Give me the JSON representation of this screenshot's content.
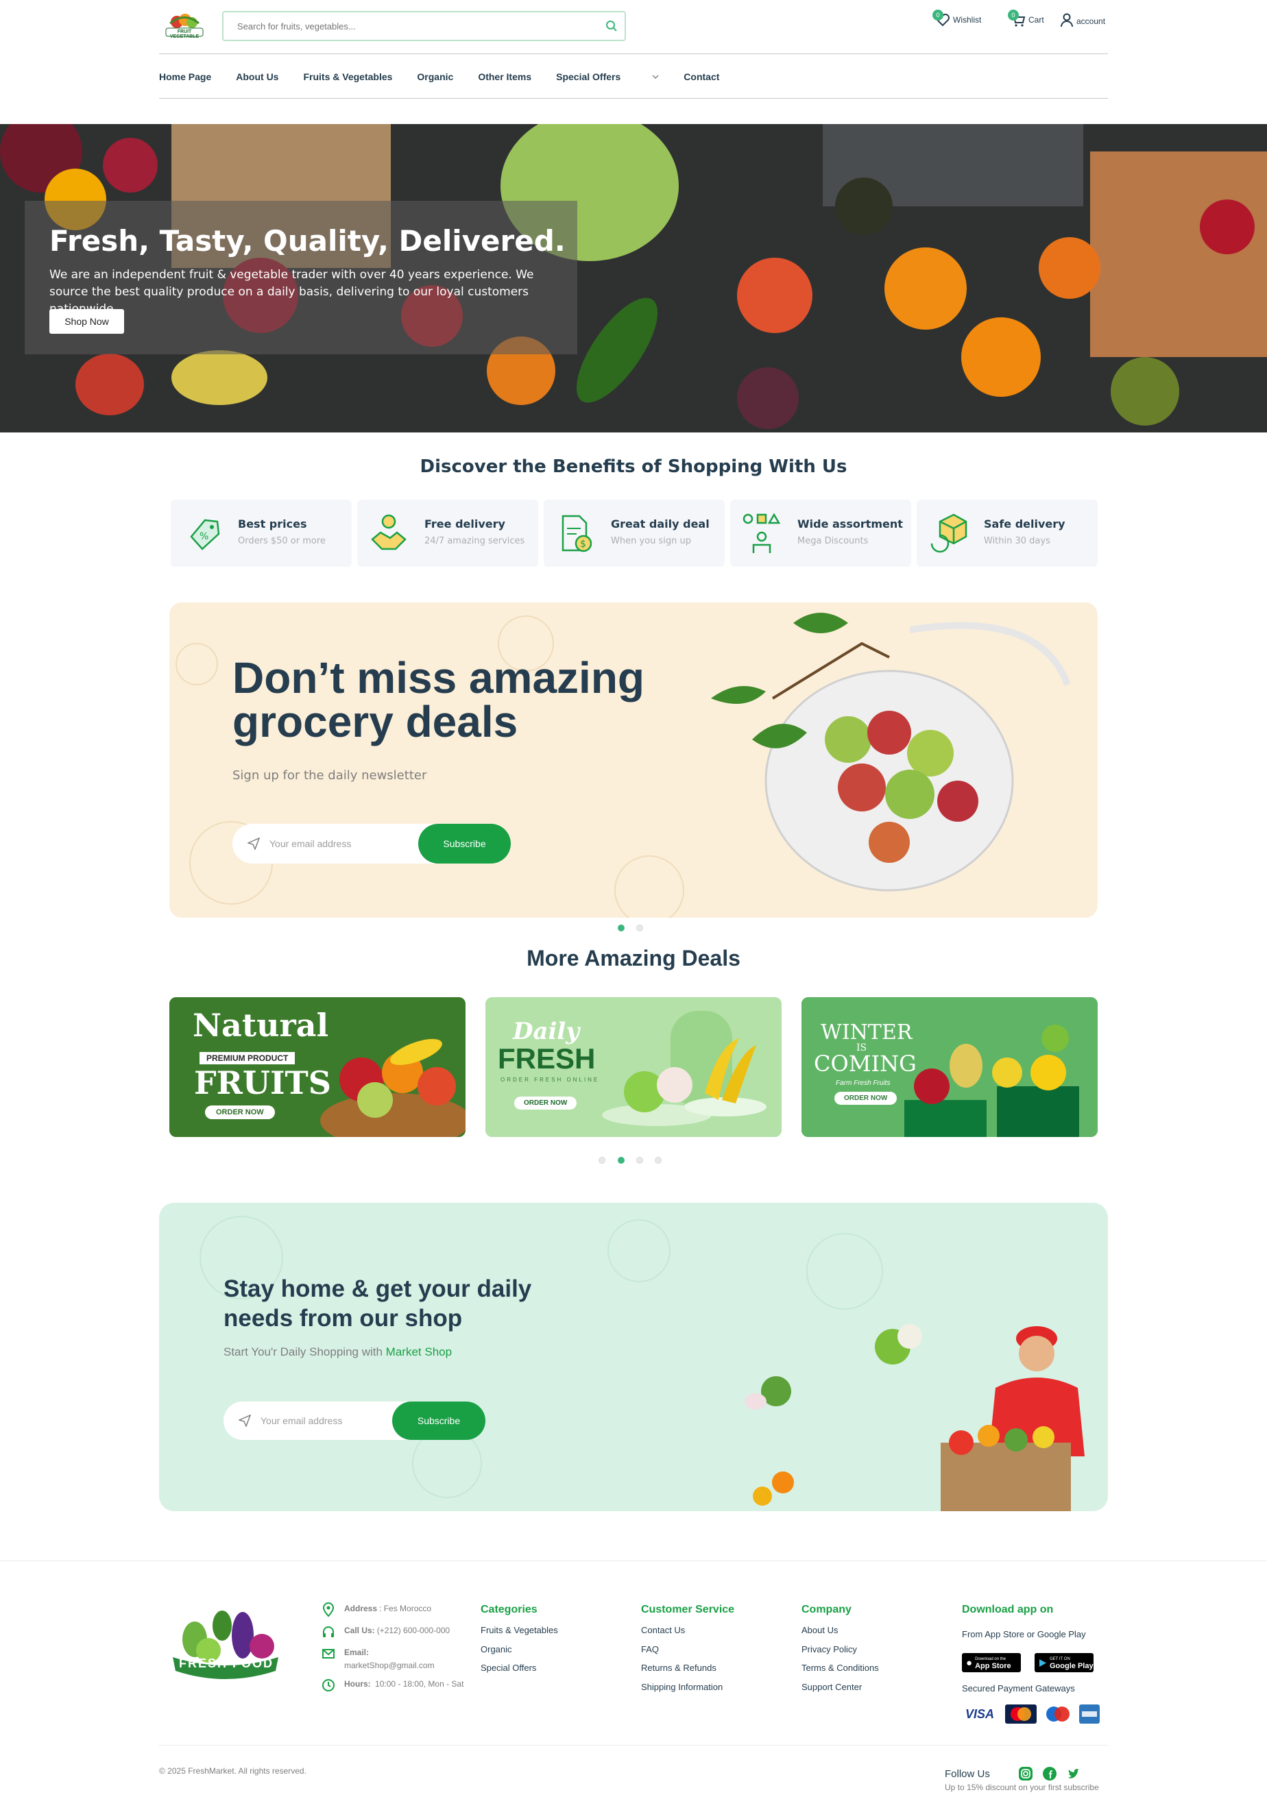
{
  "header": {
    "logo_text": "FRUIT VEGETABLE",
    "search_placeholder": "Search for fruits, vegetables...",
    "wishlist_label": "Wishlist",
    "wishlist_count": "0",
    "cart_label": "Cart",
    "cart_count": "0",
    "account_label": "account"
  },
  "nav": {
    "items": [
      "Home Page",
      "About Us",
      "Fruits & Vegetables",
      "Organic",
      "Other Items",
      "Special Offers",
      "Contact"
    ]
  },
  "hero": {
    "title": "Fresh, Tasty, Quality, Delivered.",
    "description": "We are an independent fruit & vegetable trader with over 40 years experience. We source the best quality produce on a daily basis, delivering to our loyal customers nationwide.",
    "button": "Shop Now"
  },
  "benefits": {
    "title": "Discover the Benefits of Shopping With Us",
    "items": [
      {
        "title": "Best prices",
        "subtitle": "Orders $50 or more",
        "icon": "price-tag-icon"
      },
      {
        "title": "Free delivery",
        "subtitle": "24/7 amazing services",
        "icon": "delivery-handshake-icon"
      },
      {
        "title": "Great daily deal",
        "subtitle": "When you sign up",
        "icon": "deal-document-icon"
      },
      {
        "title": "Wide assortment",
        "subtitle": "Mega Discounts",
        "icon": "assortment-icon"
      },
      {
        "title": "Safe delivery",
        "subtitle": "Within 30 days",
        "icon": "return-box-icon"
      }
    ]
  },
  "newsletter": {
    "title_line1": "Don’t miss amazing",
    "title_line2": "grocery deals",
    "subtitle": "Sign up for the daily newsletter",
    "email_placeholder": "Your email address",
    "button": "Subscribe",
    "active_slide": 1,
    "slide_count": 2
  },
  "deals": {
    "title": "More Amazing Deals",
    "cards": [
      {
        "line1": "Natural",
        "line2": "PREMIUM PRODUCT",
        "line3": "FRUITS",
        "cta": "ORDER NOW"
      },
      {
        "line1": "Daily",
        "line2": "FRESH",
        "line3": "ORDER FRESH ONLINE",
        "cta": "ORDER NOW"
      },
      {
        "line1": "WINTER",
        "line2": "IS",
        "line3": "COMING",
        "line4": "Farm Fresh Fruits",
        "cta": "ORDER NOW"
      }
    ],
    "active_slide": 2,
    "slide_count": 4
  },
  "stay": {
    "title_line1": "Stay home & get your daily",
    "title_line2": "needs from our shop",
    "subtitle_prefix": "Start You'r Daily Shopping with ",
    "subtitle_highlight": "Market Shop",
    "email_placeholder": "Your email address",
    "button": "Subscribe"
  },
  "footer": {
    "logo_text": "FRESH FOOD",
    "contact": {
      "address_label": "Address",
      "address_value": ": Fes Morocco",
      "call_label": "Call Us:",
      "call_value": "(+212) 600-000-000",
      "email_label": "Email:",
      "email_value": "marketShop@gmail.com",
      "hours_label": "Hours:",
      "hours_value": "10:00 - 18:00, Mon - Sat"
    },
    "categories": {
      "title": "Categories",
      "links": [
        "Fruits & Vegetables",
        "Organic",
        "Special Offers"
      ]
    },
    "customer_service": {
      "title": "Customer Service",
      "links": [
        "Contact Us",
        "FAQ",
        "Returns & Refunds",
        "Shipping Information"
      ]
    },
    "company": {
      "title": "Company",
      "links": [
        "About Us",
        "Privacy Policy",
        "Terms & Conditions",
        "Support Center"
      ]
    },
    "app": {
      "title": "Download app on",
      "subtitle": "From App Store or Google Play",
      "appstore_small": "Download on the",
      "appstore_big": "App Store",
      "googleplay_small": "GET IT ON",
      "googleplay_big": "Google Play",
      "payments_label": "Secured Payment Gateways",
      "payments": [
        "VISA",
        "MasterCard",
        "Maestro",
        "AMEX"
      ]
    },
    "copyright": "© 2025 FreshMarket. All rights reserved.",
    "follow_label": "Follow Us",
    "follow_sub": "Up to 15% discount on your first subscribe"
  },
  "colors": {
    "brand_green": "#19a045",
    "accent_green": "#3bb77e",
    "heading": "#253d4e",
    "newsletter_bg": "#fcefd9",
    "stay_bg": "#d8f1e5"
  }
}
